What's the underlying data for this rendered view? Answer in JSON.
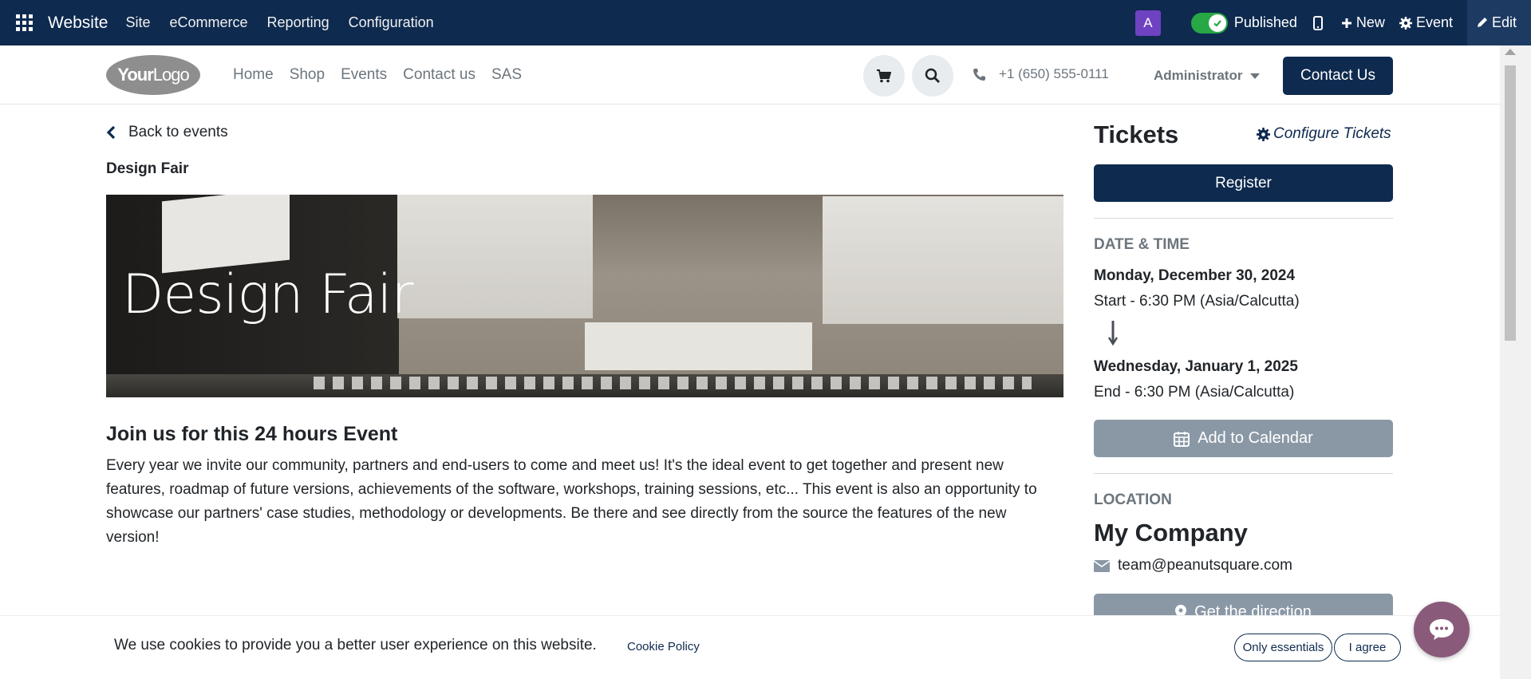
{
  "adminbar": {
    "brand": "Website",
    "menu": [
      "Site",
      "eCommerce",
      "Reporting",
      "Configuration"
    ],
    "avatar_letter": "A",
    "published_label": "Published",
    "new_label": "New",
    "event_label": "Event",
    "edit_label": "Edit"
  },
  "header": {
    "logo_bold": "Your",
    "logo_light": "Logo",
    "nav": [
      "Home",
      "Shop",
      "Events",
      "Contact us",
      "SAS"
    ],
    "phone": "+1 (650) 555-0111",
    "user": "Administrator",
    "contact_button": "Contact Us"
  },
  "main": {
    "back_label": "Back to events",
    "event_name": "Design Fair",
    "hero_title": "Design Fair",
    "headline": "Join us for this 24 hours Event",
    "description": "Every year we invite our community, partners and end-users to come and meet us! It's the ideal event to get together and present new features, roadmap of future versions, achievements of the software, workshops, training sessions, etc... This event is also an opportunity to showcase our partners' case studies, methodology or developments. Be there and see directly from the source the features of the new version!"
  },
  "sidebar": {
    "tickets_title": "Tickets",
    "configure_label": "Configure Tickets",
    "register_label": "Register",
    "datetime_label": "DATE & TIME",
    "start_date": "Monday, December 30, 2024",
    "start_time": "Start - 6:30 PM (Asia/Calcutta)",
    "end_date": "Wednesday, January 1, 2025",
    "end_time": "End - 6:30 PM (Asia/Calcutta)",
    "calendar_label": "Add to Calendar",
    "location_label": "LOCATION",
    "company": "My Company",
    "email": "team@peanutsquare.com",
    "direction_label": "Get the direction"
  },
  "cookie": {
    "text": "We use cookies to provide you a better user experience on this website.",
    "policy_link": "Cookie Policy",
    "essentials_label": "Only essentials",
    "agree_label": "I agree"
  },
  "colors": {
    "primary": "#0e2a4f",
    "secondary_button": "#8a98a6",
    "toggle_on": "#28a745",
    "avatar": "#6f42c1",
    "chat_bubble": "#8a5a7a"
  },
  "icons": [
    "apps-icon",
    "check-icon",
    "mobile-icon",
    "plus-icon",
    "gear-icon",
    "pencil-icon",
    "cart-icon",
    "search-icon",
    "phone-icon",
    "chevron-left-icon",
    "arrow-down-icon",
    "calendar-icon",
    "envelope-icon",
    "map-marker-icon",
    "chat-icon"
  ]
}
